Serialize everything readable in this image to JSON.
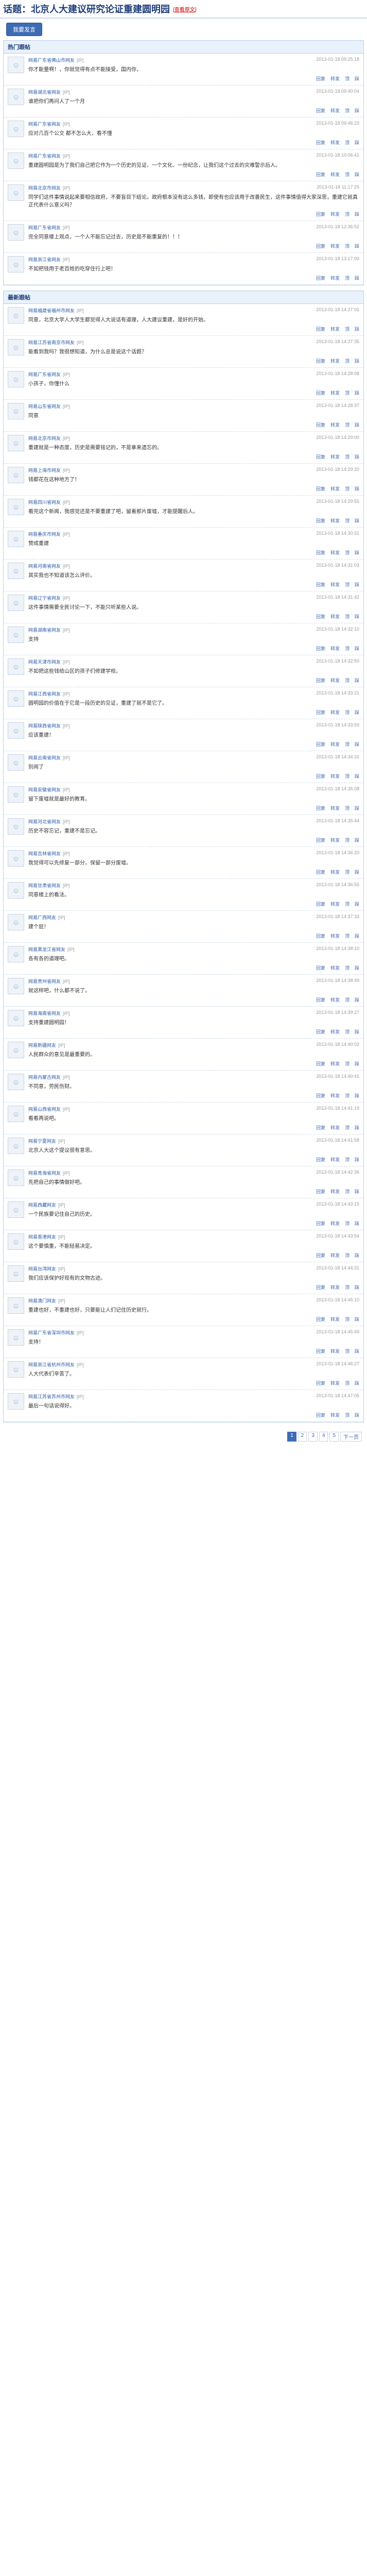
{
  "topic": {
    "prefix": "话题：",
    "title": "北京人大建议研究论证重建圆明园",
    "link_label": "[查看原文]"
  },
  "topbar": {
    "post_button": "我要发言"
  },
  "hot": {
    "title": "热门跟帖",
    "posts": [
      {
        "user": "网易广东省佛山市网友",
        "loc": "[IP]",
        "time": "2013-01-18 09:25:18",
        "content": "你才能量啊！，你就觉得有点不能接受，国内你，",
        "actions": [
          "回复",
          "转发",
          "顶",
          "踩"
        ]
      },
      {
        "user": "网易湖北省网友",
        "loc": "[IP]",
        "time": "2013-01-18 09:40:04",
        "content": "谁把你们再问人了一个月",
        "actions": [
          "回复",
          "转发",
          "顶",
          "踩"
        ]
      },
      {
        "user": "网易广东省网友",
        "loc": "[IP]",
        "time": "2013-01-18 09:46:23",
        "content": "应对几百个公交 都不怎么大，看不懂",
        "actions": [
          "回复",
          "转发",
          "顶",
          "踩"
        ]
      },
      {
        "user": "网易广东省网友",
        "loc": "[IP]",
        "time": "2013-01-18 10:06:41",
        "content": "重建圆明园是为了我们自己把它作为一个历史的见证、一个文化、一份纪念，让我们这个过去的灾难警示后人。",
        "actions": [
          "回复",
          "转发",
          "顶",
          "踩"
        ]
      },
      {
        "user": "网易北京市网友",
        "loc": "[IP]",
        "time": "2013-01-18 11:17:25",
        "content": "同学们这件事情说起来要相信政府，不要盲目下结论。政府根本没有这么多钱，即使有也应该用于改善民生，这件事情值得大家深思，重建它就真正代表什么意义吗？",
        "actions": [
          "回复",
          "转发",
          "顶",
          "踩"
        ]
      },
      {
        "user": "网易广东省网友",
        "loc": "[IP]",
        "time": "2013-01-18 12:36:52",
        "content": "完全同意楼上观点，一个人不能忘记过去，历史是不能重复的！！！",
        "actions": [
          "回复",
          "转发",
          "顶",
          "踩"
        ]
      },
      {
        "user": "网易浙江省网友",
        "loc": "[IP]",
        "time": "2013-01-18 13:17:00",
        "content": "不如把钱用于老百姓的吃穿住行上吧！",
        "actions": [
          "回复",
          "转发",
          "顶",
          "踩"
        ]
      }
    ]
  },
  "latest": {
    "title": "最新跟帖",
    "posts": [
      {
        "user": "网易福建省福州市网友",
        "loc": "[IP]",
        "time": "2013-01-18 14:27:01",
        "content": "同意，北京大学人大学生都觉得人大说话有道理，人大建议重建，是好的开始。",
        "actions": [
          "回复",
          "转发",
          "顶",
          "踩"
        ]
      },
      {
        "user": "网易江苏省南京市网友",
        "loc": "[IP]",
        "time": "2013-01-18 14:27:35",
        "content": "能看到我吗？我很想知道，为什么总是说这个话题？",
        "actions": [
          "回复",
          "转发",
          "顶",
          "踩"
        ]
      },
      {
        "user": "网易广东省网友",
        "loc": "[IP]",
        "time": "2013-01-18 14:28:08",
        "content": "小孩子，你懂什么",
        "actions": [
          "回复",
          "转发",
          "顶",
          "踩"
        ]
      },
      {
        "user": "网易山东省网友",
        "loc": "[IP]",
        "time": "2013-01-18 14:28:37",
        "content": "同意",
        "actions": [
          "回复",
          "转发",
          "顶",
          "踩"
        ]
      },
      {
        "user": "网易北京市网友",
        "loc": "[IP]",
        "time": "2013-01-18 14:29:00",
        "content": "重建就是一种态度，历史是需要铭记的，不是拿来遗忘的。",
        "actions": [
          "回复",
          "转发",
          "顶",
          "踩"
        ]
      },
      {
        "user": "网易上海市网友",
        "loc": "[IP]",
        "time": "2013-01-18 14:29:20",
        "content": "钱都花在这种地方了！",
        "actions": [
          "回复",
          "转发",
          "顶",
          "踩"
        ]
      },
      {
        "user": "网易四川省网友",
        "loc": "[IP]",
        "time": "2013-01-18 14:29:55",
        "content": "看完这个新闻，我感觉还是不要重建了吧，留着那片废墟，才能提醒后人。",
        "actions": [
          "回复",
          "转发",
          "顶",
          "踩"
        ]
      },
      {
        "user": "网易重庆市网友",
        "loc": "[IP]",
        "time": "2013-01-18 14:30:31",
        "content": "赞成重建",
        "actions": [
          "回复",
          "转发",
          "顶",
          "踩"
        ]
      },
      {
        "user": "网易河南省网友",
        "loc": "[IP]",
        "time": "2013-01-18 14:31:03",
        "content": "其实我也不知道该怎么评价。",
        "actions": [
          "回复",
          "转发",
          "顶",
          "踩"
        ]
      },
      {
        "user": "网易辽宁省网友",
        "loc": "[IP]",
        "time": "2013-01-18 14:31:42",
        "content": "这件事情需要全民讨论一下，不能只听某些人说。",
        "actions": [
          "回复",
          "转发",
          "顶",
          "踩"
        ]
      },
      {
        "user": "网易湖南省网友",
        "loc": "[IP]",
        "time": "2013-01-18 14:32:10",
        "content": "支持",
        "actions": [
          "回复",
          "转发",
          "顶",
          "踩"
        ]
      },
      {
        "user": "网易天津市网友",
        "loc": "[IP]",
        "time": "2013-01-18 14:32:50",
        "content": "不如把这些钱给山区的孩子们修建学校。",
        "actions": [
          "回复",
          "转发",
          "顶",
          "踩"
        ]
      },
      {
        "user": "网易江西省网友",
        "loc": "[IP]",
        "time": "2013-01-18 14:33:21",
        "content": "圆明园的价值在于它是一段历史的见证，重建了就不是它了。",
        "actions": [
          "回复",
          "转发",
          "顶",
          "踩"
        ]
      },
      {
        "user": "网易陕西省网友",
        "loc": "[IP]",
        "time": "2013-01-18 14:33:59",
        "content": "应该重建！",
        "actions": [
          "回复",
          "转发",
          "顶",
          "踩"
        ]
      },
      {
        "user": "网易云南省网友",
        "loc": "[IP]",
        "time": "2013-01-18 14:34:31",
        "content": "别闹了",
        "actions": [
          "回复",
          "转发",
          "顶",
          "踩"
        ]
      },
      {
        "user": "网易安徽省网友",
        "loc": "[IP]",
        "time": "2013-01-18 14:35:08",
        "content": "留下废墟就是最好的教育。",
        "actions": [
          "回复",
          "转发",
          "顶",
          "踩"
        ]
      },
      {
        "user": "网易河北省网友",
        "loc": "[IP]",
        "time": "2013-01-18 14:35:44",
        "content": "历史不容忘记，重建不是忘记。",
        "actions": [
          "回复",
          "转发",
          "顶",
          "踩"
        ]
      },
      {
        "user": "网易吉林省网友",
        "loc": "[IP]",
        "time": "2013-01-18 14:36:20",
        "content": "我觉得可以先修复一部分，保留一部分废墟。",
        "actions": [
          "回复",
          "转发",
          "顶",
          "踩"
        ]
      },
      {
        "user": "网易甘肃省网友",
        "loc": "[IP]",
        "time": "2013-01-18 14:36:55",
        "content": "同意楼上的看法。",
        "actions": [
          "回复",
          "转发",
          "顶",
          "踩"
        ]
      },
      {
        "user": "网易广西网友",
        "loc": "[IP]",
        "time": "2013-01-18 14:37:33",
        "content": "建个屁！",
        "actions": [
          "回复",
          "转发",
          "顶",
          "踩"
        ]
      },
      {
        "user": "网易黑龙江省网友",
        "loc": "[IP]",
        "time": "2013-01-18 14:38:10",
        "content": "各有各的道理吧。",
        "actions": [
          "回复",
          "转发",
          "顶",
          "踩"
        ]
      },
      {
        "user": "网易贵州省网友",
        "loc": "[IP]",
        "time": "2013-01-18 14:38:49",
        "content": "就这样吧，什么都不说了。",
        "actions": [
          "回复",
          "转发",
          "顶",
          "踩"
        ]
      },
      {
        "user": "网易海南省网友",
        "loc": "[IP]",
        "time": "2013-01-18 14:39:27",
        "content": "支持重建圆明园！",
        "actions": [
          "回复",
          "转发",
          "顶",
          "踩"
        ]
      },
      {
        "user": "网易新疆网友",
        "loc": "[IP]",
        "time": "2013-01-18 14:40:02",
        "content": "人民群众的意见是最重要的。",
        "actions": [
          "回复",
          "转发",
          "顶",
          "踩"
        ]
      },
      {
        "user": "网易内蒙古网友",
        "loc": "[IP]",
        "time": "2013-01-18 14:40:41",
        "content": "不同意，劳民伤财。",
        "actions": [
          "回复",
          "转发",
          "顶",
          "踩"
        ]
      },
      {
        "user": "网易山西省网友",
        "loc": "[IP]",
        "time": "2013-01-18 14:41:19",
        "content": "看看再说吧。",
        "actions": [
          "回复",
          "转发",
          "顶",
          "踩"
        ]
      },
      {
        "user": "网易宁夏网友",
        "loc": "[IP]",
        "time": "2013-01-18 14:41:58",
        "content": "北京人大这个提议很有意思。",
        "actions": [
          "回复",
          "转发",
          "顶",
          "踩"
        ]
      },
      {
        "user": "网易青海省网友",
        "loc": "[IP]",
        "time": "2013-01-18 14:42:36",
        "content": "先把自己的事情做好吧。",
        "actions": [
          "回复",
          "转发",
          "顶",
          "踩"
        ]
      },
      {
        "user": "网易西藏网友",
        "loc": "[IP]",
        "time": "2013-01-18 14:43:15",
        "content": "一个民族要记住自己的历史。",
        "actions": [
          "回复",
          "转发",
          "顶",
          "踩"
        ]
      },
      {
        "user": "网易香港网友",
        "loc": "[IP]",
        "time": "2013-01-18 14:43:54",
        "content": "这个要慎重，不能轻易决定。",
        "actions": [
          "回复",
          "转发",
          "顶",
          "踩"
        ]
      },
      {
        "user": "网易台湾网友",
        "loc": "[IP]",
        "time": "2013-01-18 14:44:31",
        "content": "我们应该保护好现有的文物古迹。",
        "actions": [
          "回复",
          "转发",
          "顶",
          "踩"
        ]
      },
      {
        "user": "网易澳门网友",
        "loc": "[IP]",
        "time": "2013-01-18 14:45:10",
        "content": "重建也好，不重建也好，只要能让人们记住历史就行。",
        "actions": [
          "回复",
          "转发",
          "顶",
          "踩"
        ]
      },
      {
        "user": "网易广东省深圳市网友",
        "loc": "[IP]",
        "time": "2013-01-18 14:45:49",
        "content": "支持！",
        "actions": [
          "回复",
          "转发",
          "顶",
          "踩"
        ]
      },
      {
        "user": "网易浙江省杭州市网友",
        "loc": "[IP]",
        "time": "2013-01-18 14:46:27",
        "content": "人大代表们辛苦了。",
        "actions": [
          "回复",
          "转发",
          "顶",
          "踩"
        ]
      },
      {
        "user": "网易江苏省苏州市网友",
        "loc": "[IP]",
        "time": "2013-01-18 14:47:05",
        "content": "最后一句话说得好。",
        "actions": [
          "回复",
          "转发",
          "顶",
          "踩"
        ]
      }
    ]
  },
  "pager": {
    "pages": [
      "1",
      "2",
      "3",
      "4",
      "5",
      "下一页"
    ],
    "current": "1"
  }
}
